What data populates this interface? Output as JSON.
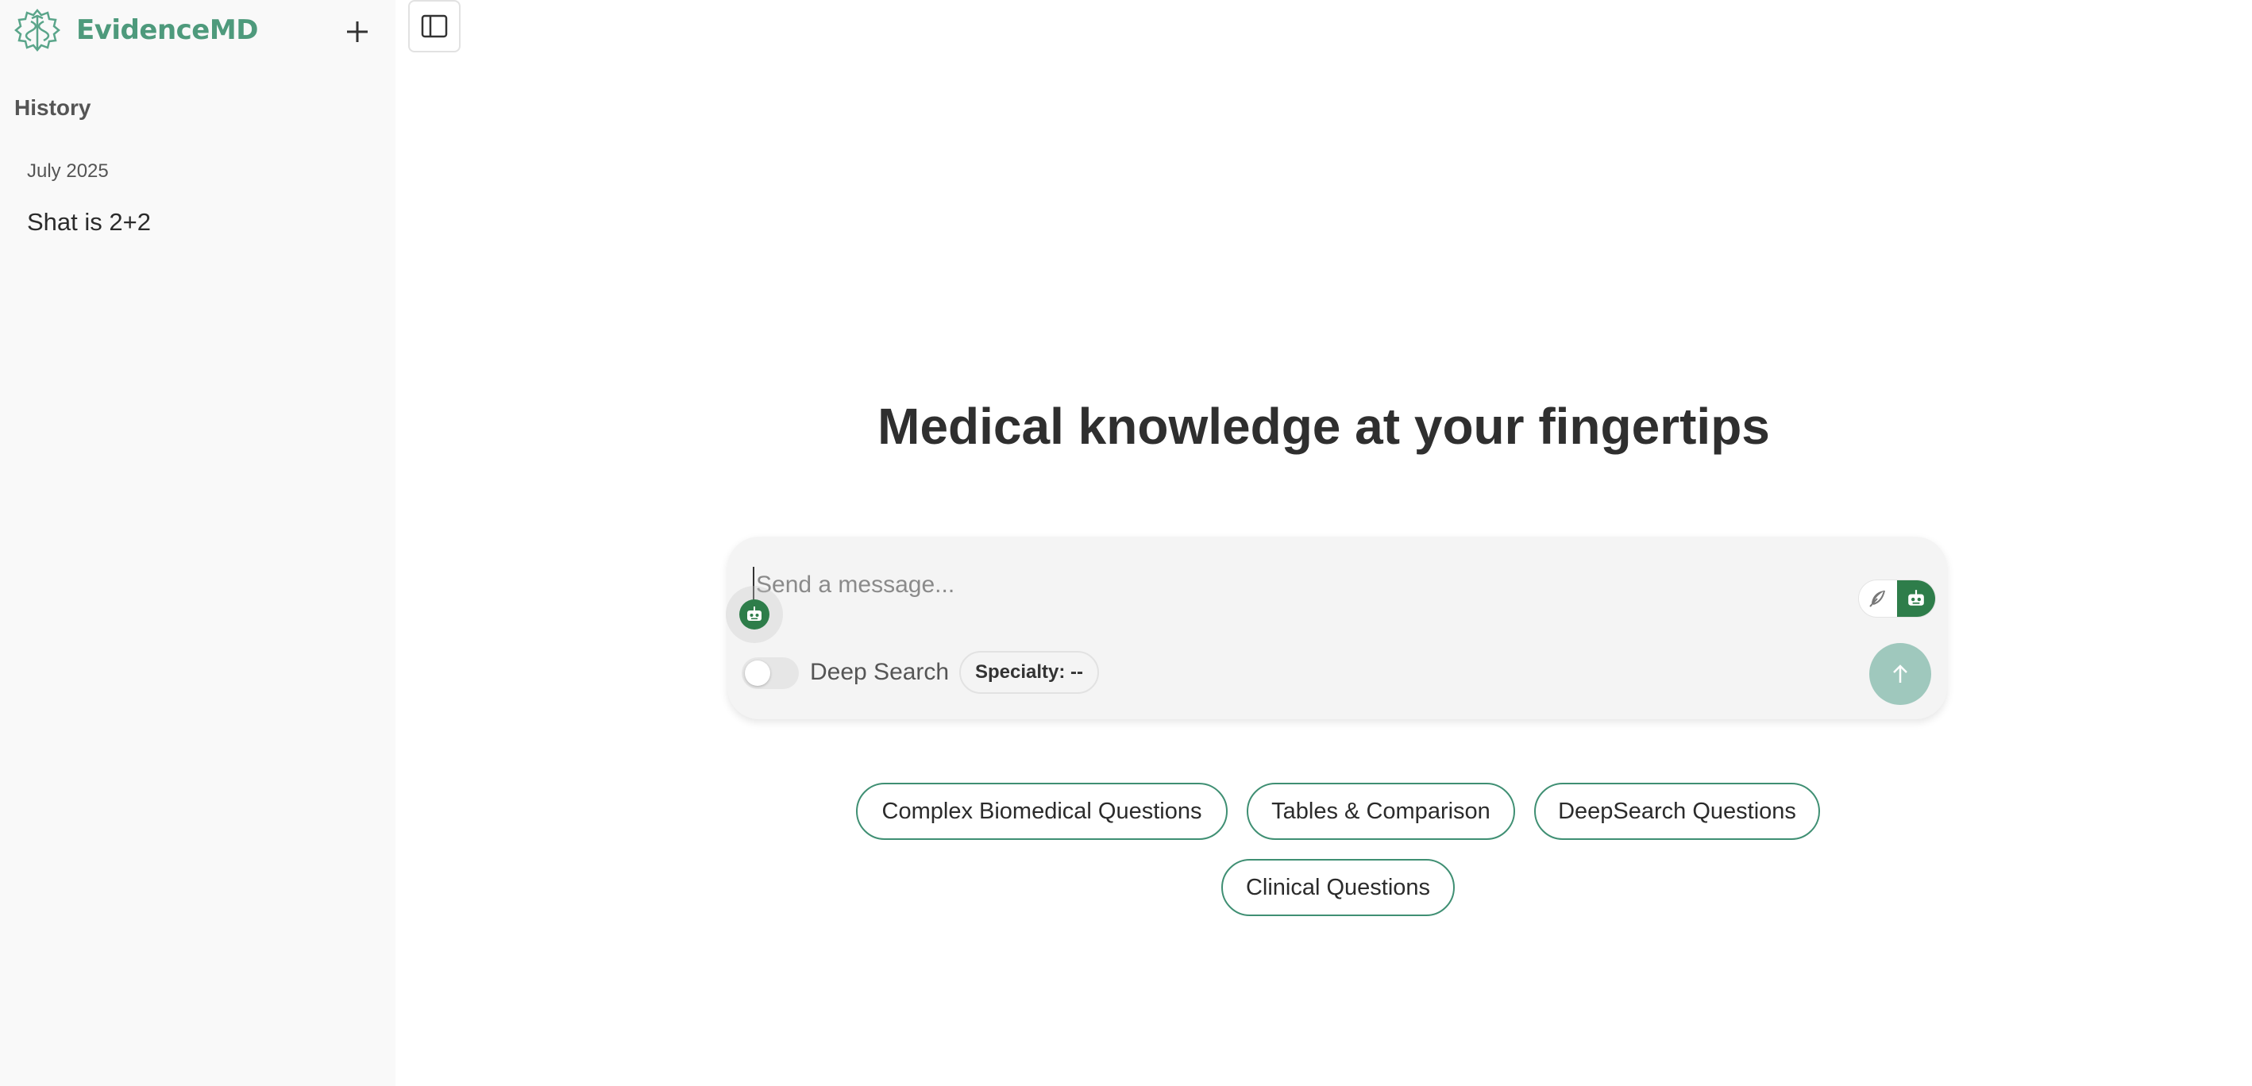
{
  "brand": {
    "name": "EvidenceMD",
    "accent": "#4e9a7c"
  },
  "sidebar": {
    "new_chat_icon": "plus-icon",
    "history_heading": "History",
    "groups": [
      {
        "label": "July 2025",
        "items": [
          {
            "label": "Shat is 2+2"
          }
        ]
      }
    ]
  },
  "toggle_icon": "sidebar-panel-icon",
  "main": {
    "headline": "Medical knowledge at your fingertips",
    "composer": {
      "placeholder": "Send a message...",
      "deep_search_label": "Deep Search",
      "deep_search_on": false,
      "specialty_label": "Specialty: --",
      "mode_icons": [
        "feather-icon",
        "robot-icon"
      ],
      "send_icon": "arrow-up-icon"
    },
    "suggestions": [
      "Complex Biomedical Questions",
      "Tables & Comparison",
      "DeepSearch Questions",
      "Clinical Questions"
    ]
  },
  "colors": {
    "primary_green": "#2e7d4a",
    "send_disabled": "#9fc8bd",
    "chip_border": "#3f8f73"
  }
}
